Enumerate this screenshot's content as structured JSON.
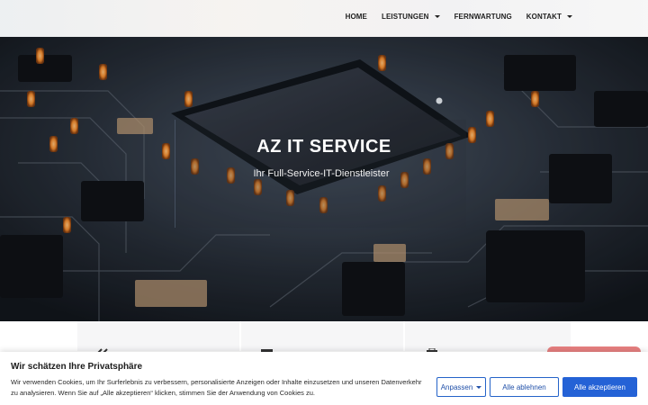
{
  "nav": {
    "items": [
      {
        "label": "HOME",
        "dropdown": false
      },
      {
        "label": "LEISTUNGEN",
        "dropdown": true
      },
      {
        "label": "FERNWARTUNG",
        "dropdown": false
      },
      {
        "label": "KONTAKT",
        "dropdown": true
      }
    ]
  },
  "hero": {
    "title": "AZ IT SERVICE",
    "subtitle": "Ihr Full-Service-IT-Dienstleister"
  },
  "cookie": {
    "title": "Wir schätzen Ihre Privatsphäre",
    "text": "Wir verwenden Cookies, um Ihr Surferlebnis zu verbessern, personalisierte Anzeigen oder Inhalte einzusetzen und unseren Datenverkehr zu analysieren. Wenn Sie auf „Alle akzeptieren“ klicken, stimmen Sie der Anwendung von Cookies zu.",
    "customize_label": "Anpassen",
    "reject_label": "Alle ablehnen",
    "accept_label": "Alle akzeptieren"
  },
  "colors": {
    "accent": "#2462d6",
    "nav_text": "#1f1f1f",
    "hero_glow": "#f08a2e"
  }
}
